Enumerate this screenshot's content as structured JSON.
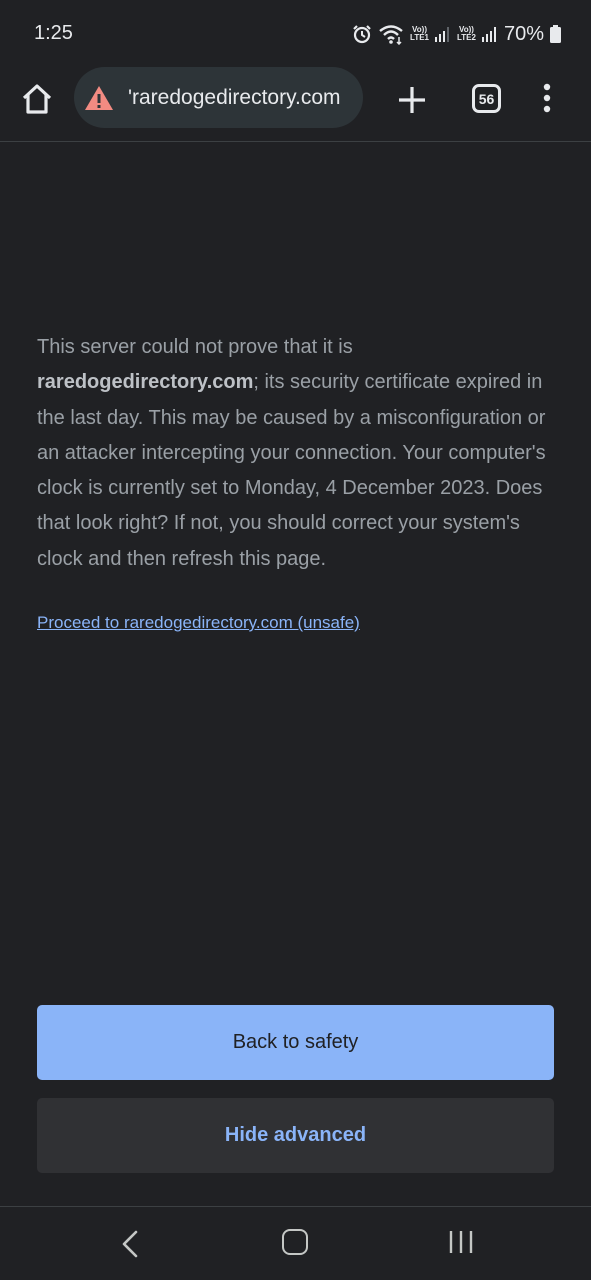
{
  "status_bar": {
    "time": "1:25",
    "sim1_label_top": "Vo))",
    "sim1_label_bottom": "LTE1",
    "sim2_label_top": "Vo))",
    "sim2_label_bottom": "LTE2",
    "battery": "70%",
    "icons": [
      "alarm-icon",
      "wifi-icon",
      "signal-icon",
      "battery-icon"
    ]
  },
  "toolbar": {
    "url": "'raredogedirectory.com",
    "tab_count": "56",
    "icons": [
      "home-icon",
      "warning-icon",
      "plus-icon",
      "tabs-icon",
      "more-vert-icon"
    ]
  },
  "interstitial": {
    "message_part1": "This server could not prove that it is ",
    "domain": "raredogedirectory.com",
    "message_part2": "; its security certificate expired in the last day. This may be caused by a misconfiguration or an attacker intercepting your connection. Your computer's clock is currently set to Monday, 4 December 2023. Does that look right? If not, you should correct your system's clock and then refresh this page.",
    "proceed_link": "Proceed to raredogedirectory.com (unsafe)",
    "back_button": "Back to safety",
    "hide_advanced_button": "Hide advanced"
  },
  "colors": {
    "background": "#202124",
    "primary_button": "#8ab4f8",
    "secondary_button": "#303134",
    "link": "#8ab4f8",
    "warning": "#f28b82"
  },
  "nav_bar": {
    "icons": [
      "back-icon",
      "home-nav-icon",
      "recents-icon"
    ]
  }
}
